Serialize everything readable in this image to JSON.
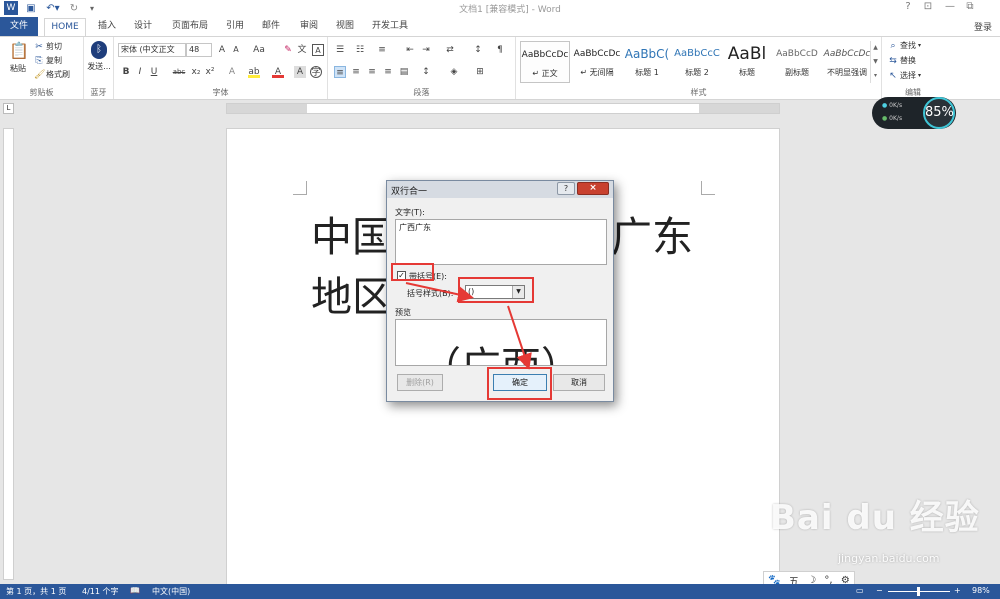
{
  "titlebar": {
    "title": "文档1 [兼容模式] - Word",
    "icons": [
      "word-app-icon",
      "save-icon",
      "undo-icon",
      "redo-icon",
      "customize-icon"
    ],
    "controls": [
      "?",
      "⊡",
      "—",
      "⧉"
    ]
  },
  "tabs": {
    "file": "文件",
    "items": [
      "HOME",
      "插入",
      "设计",
      "页面布局",
      "引用",
      "邮件",
      "审阅",
      "视图",
      "开发工具"
    ],
    "login": "登录"
  },
  "ribbon": {
    "clipboard": {
      "paste": "粘贴",
      "cut": "剪切",
      "copy": "复制",
      "format_painter": "格式刷",
      "label": "剪贴板"
    },
    "bluetooth": {
      "send": "发送...",
      "label": "蓝牙"
    },
    "font": {
      "name": "宋体 (中文正文",
      "size": "48",
      "label": "字体",
      "buttons": [
        "B",
        "I",
        "U",
        "abc",
        "x₂",
        "x²"
      ],
      "aa": "Aa"
    },
    "paragraph": {
      "label": "段落"
    },
    "styles": {
      "label": "样式",
      "items": [
        {
          "sample": "AaBbCcDc",
          "name": "↵ 正文"
        },
        {
          "sample": "AaBbCcDc",
          "name": "↵ 无间隔"
        },
        {
          "sample": "AaBbC(",
          "name": "标题 1"
        },
        {
          "sample": "AaBbCcC",
          "name": "标题 2"
        },
        {
          "sample": "AaBl",
          "name": "标题"
        },
        {
          "sample": "AaBbCcD",
          "name": "副标题"
        },
        {
          "sample": "AaBbCcDc",
          "name": "不明显强调"
        }
      ]
    },
    "editing": {
      "find": "查找",
      "replace": "替换",
      "select": "选择",
      "label": "编辑"
    }
  },
  "document": {
    "line1_left": "中国",
    "line1_right": "广东",
    "line2_left": "地区"
  },
  "dialog": {
    "title": "双行合一",
    "help": "?",
    "close": "×",
    "text_label": "文字(T):",
    "text_value": "广西广东",
    "bracket_label": "带括号(E):",
    "bracket_checked": "✓",
    "bracket_style_label": "括号样式(B):",
    "bracket_style_value": "()",
    "preview_label": "预览",
    "preview_text": "（广西）",
    "delete_btn": "删除(R)",
    "ok_btn": "确定",
    "cancel_btn": "取消"
  },
  "netmon": {
    "percent": "85%",
    "up": "0K/s",
    "down": "0K/s"
  },
  "statusbar": {
    "page": "第 1 页，共 1 页",
    "words": "4/11 个字",
    "lang": "中文(中国)",
    "zoom": "98%",
    "minus": "−",
    "plus": "+"
  },
  "tray": {
    "ime": "五"
  },
  "watermark": {
    "brand": "Bai du 经验",
    "url": "jingyan.baidu.com"
  }
}
